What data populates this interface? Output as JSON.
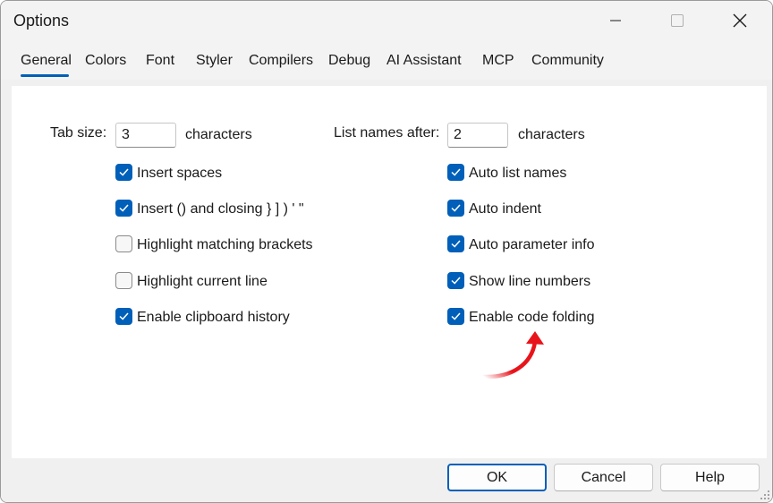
{
  "window": {
    "title": "Options"
  },
  "tabs": [
    {
      "label": "General",
      "active": true
    },
    {
      "label": "Colors"
    },
    {
      "label": "Font"
    },
    {
      "label": "Styler"
    },
    {
      "label": "Compilers"
    },
    {
      "label": "Debug"
    },
    {
      "label": "AI Assistant"
    },
    {
      "label": "MCP"
    },
    {
      "label": "Community"
    }
  ],
  "left": {
    "tab_size_label": "Tab size:",
    "tab_size_value": "3",
    "tab_size_unit": "characters",
    "options": [
      {
        "label": "Insert spaces",
        "checked": true
      },
      {
        "label": "Insert () and closing } ] ) ' \"",
        "checked": true
      },
      {
        "label": "Highlight matching brackets",
        "checked": false
      },
      {
        "label": "Highlight current line",
        "checked": false
      },
      {
        "label": "Enable clipboard history",
        "checked": true
      }
    ]
  },
  "right": {
    "list_names_label": "List names after:",
    "list_names_value": "2",
    "list_names_unit": "characters",
    "options": [
      {
        "label": "Auto list names",
        "checked": true
      },
      {
        "label": "Auto indent",
        "checked": true
      },
      {
        "label": "Auto parameter info",
        "checked": true
      },
      {
        "label": "Show line numbers",
        "checked": true
      },
      {
        "label": "Enable code folding",
        "checked": true
      }
    ]
  },
  "buttons": {
    "ok": "OK",
    "cancel": "Cancel",
    "help": "Help"
  },
  "colors": {
    "accent": "#005fb8",
    "annotation_arrow": "#e8141b"
  }
}
